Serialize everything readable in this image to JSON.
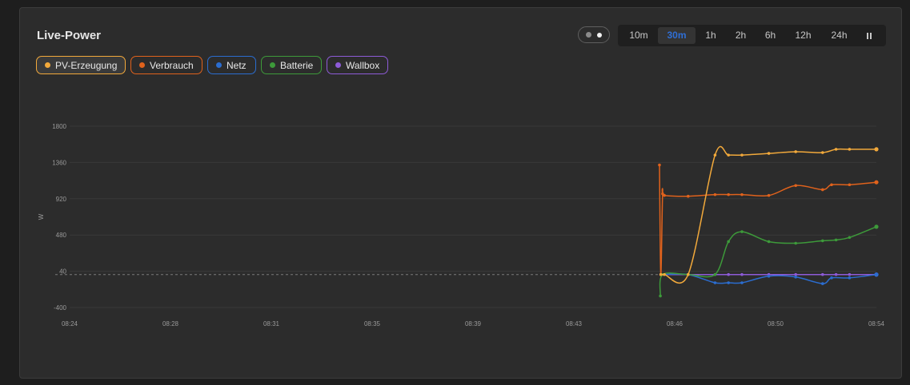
{
  "header": {
    "title": "Live-Power"
  },
  "view_toggle": {
    "icon": "two-dots-toggle-icon"
  },
  "ranges": [
    "10m",
    "30m",
    "1h",
    "2h",
    "6h",
    "12h",
    "24h"
  ],
  "active_range": "30m",
  "pause_icon": "pause-icon",
  "legend": [
    {
      "label": "PV-Erzeugung",
      "color": "#f2a93b",
      "active": true
    },
    {
      "label": "Verbrauch",
      "color": "#e0621c",
      "active": false
    },
    {
      "label": "Netz",
      "color": "#2b6dd0",
      "active": false
    },
    {
      "label": "Batterie",
      "color": "#3d9a3a",
      "active": false
    },
    {
      "label": "Wallbox",
      "color": "#8e5bd8",
      "active": false
    }
  ],
  "chart_data": {
    "type": "line",
    "ylabel": "W",
    "xlabel": "",
    "ylim": [
      -400,
      1800
    ],
    "y_ticks": [
      1800,
      1360,
      920,
      480,
      40,
      -400
    ],
    "x_range": [
      "08:24",
      "08:54"
    ],
    "x_ticks": [
      "08:24",
      "08:28",
      "08:31",
      "08:35",
      "08:39",
      "08:43",
      "08:46",
      "08:50",
      "08:54"
    ],
    "grid": true,
    "zero_line": "dashed",
    "series": [
      {
        "name": "PV-Erzeugung",
        "color": "#f2a93b",
        "points": [
          [
            "08:45:59",
            0
          ],
          [
            "08:46:07",
            0
          ],
          [
            "08:47:00",
            0
          ],
          [
            "08:48:00",
            1450
          ],
          [
            "08:48:30",
            1450
          ],
          [
            "08:49:00",
            1450
          ],
          [
            "08:50:00",
            1470
          ],
          [
            "08:51:00",
            1490
          ],
          [
            "08:52:00",
            1480
          ],
          [
            "08:52:30",
            1520
          ],
          [
            "08:53:00",
            1520
          ],
          [
            "08:54:00",
            1520
          ]
        ]
      },
      {
        "name": "Verbrauch",
        "color": "#e0621c",
        "points": [
          [
            "08:45:56",
            1330
          ],
          [
            "08:45:59",
            0
          ],
          [
            "08:46:03",
            980
          ],
          [
            "08:46:07",
            960
          ],
          [
            "08:47:00",
            950
          ],
          [
            "08:48:00",
            970
          ],
          [
            "08:48:30",
            970
          ],
          [
            "08:49:00",
            970
          ],
          [
            "08:50:00",
            960
          ],
          [
            "08:51:00",
            1080
          ],
          [
            "08:52:00",
            1030
          ],
          [
            "08:52:20",
            1090
          ],
          [
            "08:53:00",
            1090
          ],
          [
            "08:54:00",
            1120
          ]
        ]
      },
      {
        "name": "Netz",
        "color": "#2b6dd0",
        "points": [
          [
            "08:45:59",
            0
          ],
          [
            "08:47:00",
            0
          ],
          [
            "08:48:00",
            -100
          ],
          [
            "08:48:30",
            -100
          ],
          [
            "08:49:00",
            -100
          ],
          [
            "08:50:00",
            -20
          ],
          [
            "08:51:00",
            -30
          ],
          [
            "08:52:00",
            -110
          ],
          [
            "08:52:20",
            -40
          ],
          [
            "08:53:00",
            -40
          ],
          [
            "08:54:00",
            0
          ]
        ]
      },
      {
        "name": "Batterie",
        "color": "#3d9a3a",
        "points": [
          [
            "08:45:58",
            -260
          ],
          [
            "08:46:03",
            0
          ],
          [
            "08:47:00",
            0
          ],
          [
            "08:48:00",
            0
          ],
          [
            "08:48:30",
            400
          ],
          [
            "08:49:00",
            520
          ],
          [
            "08:50:00",
            400
          ],
          [
            "08:51:00",
            380
          ],
          [
            "08:52:00",
            410
          ],
          [
            "08:52:30",
            420
          ],
          [
            "08:53:00",
            450
          ],
          [
            "08:54:00",
            580
          ]
        ]
      },
      {
        "name": "Wallbox",
        "color": "#8e5bd8",
        "points": [
          [
            "08:45:59",
            0
          ],
          [
            "08:47:00",
            0
          ],
          [
            "08:48:00",
            0
          ],
          [
            "08:48:30",
            0
          ],
          [
            "08:49:00",
            0
          ],
          [
            "08:50:00",
            0
          ],
          [
            "08:51:00",
            0
          ],
          [
            "08:52:00",
            0
          ],
          [
            "08:52:30",
            0
          ],
          [
            "08:53:00",
            0
          ],
          [
            "08:54:00",
            0
          ]
        ]
      }
    ]
  }
}
